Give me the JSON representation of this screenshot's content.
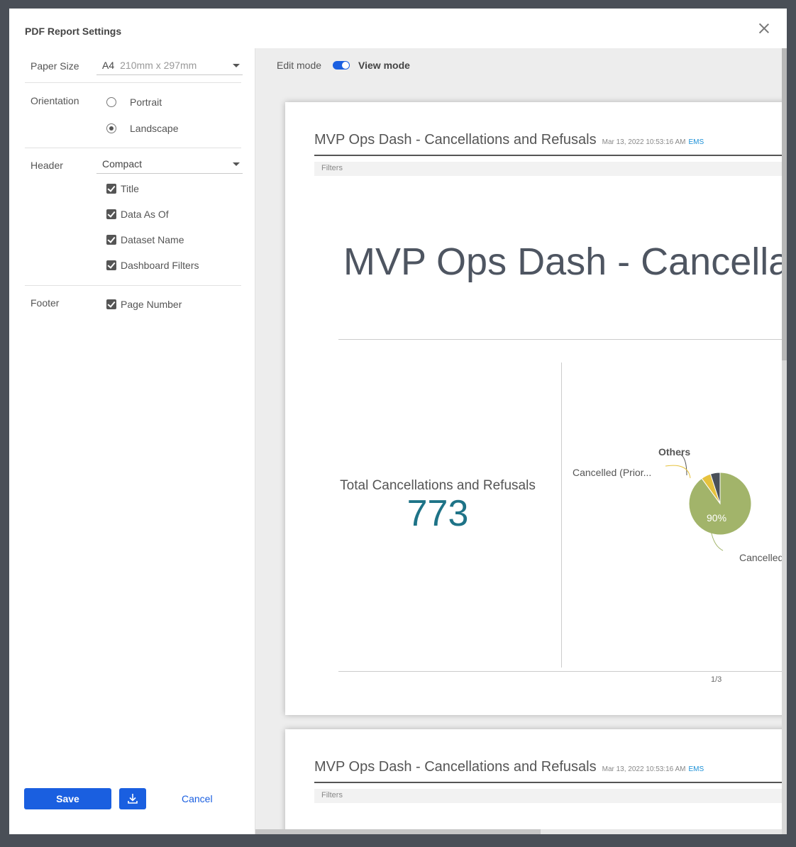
{
  "dialog": {
    "title": "PDF Report Settings"
  },
  "settings": {
    "paper_size_label": "Paper Size",
    "paper_size_value": "A4",
    "paper_size_detail": "210mm x 297mm",
    "orientation_label": "Orientation",
    "orientation_options": [
      "Portrait",
      "Landscape"
    ],
    "orientation_selected": "Landscape",
    "header_label": "Header",
    "header_value": "Compact",
    "header_checks": [
      "Title",
      "Data As Of",
      "Dataset Name",
      "Dashboard Filters"
    ],
    "footer_label": "Footer",
    "footer_checks": [
      "Page Number"
    ]
  },
  "actions": {
    "save_label": "Save",
    "cancel_label": "Cancel"
  },
  "preview": {
    "edit_mode_label": "Edit mode",
    "view_mode_label": "View mode",
    "report_title": "MVP Ops Dash - Cancellations and Refusals",
    "report_date": "Mar 13, 2022 10:53:16 AM",
    "report_source": "EMS",
    "filters_label": "Filters",
    "big_title": "MVP Ops Dash - Cancellat",
    "kpi_label": "Total Cancellations and Refusals",
    "kpi_value": "773",
    "page_number": "1/3"
  },
  "chart_data": {
    "type": "pie",
    "labels": [
      "Cancelled",
      "Cancelled (Prior...",
      "Others"
    ],
    "values": [
      90,
      5,
      5
    ],
    "slice_labels": [
      "90%",
      "",
      ""
    ],
    "colors": [
      "#a2b46a",
      "#e6c23e",
      "#4a5059"
    ]
  }
}
